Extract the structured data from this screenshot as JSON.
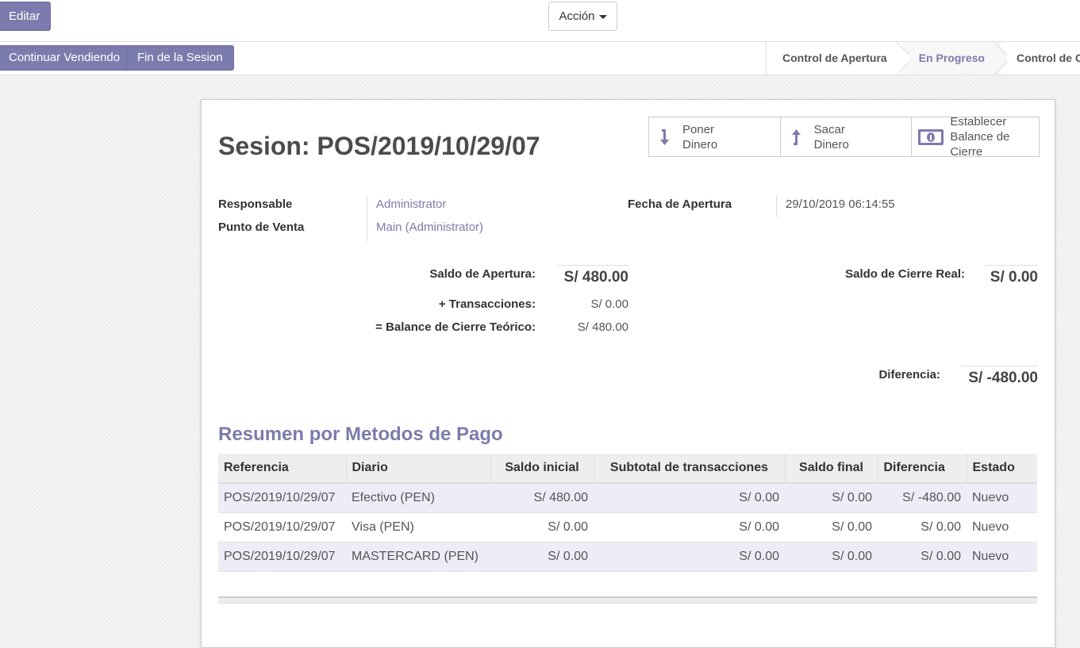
{
  "toolbar": {
    "edit_label": "Editar",
    "action_label": "Acción"
  },
  "session_buttons": {
    "continue_label": "Continuar Vendiendo",
    "end_label": "Fin de la Sesion"
  },
  "status_steps": [
    "Control de Apertura",
    "En Progreso",
    "Control de C"
  ],
  "active_step": "En Progreso",
  "form": {
    "title": "Sesion: POS/2019/10/29/07",
    "smart_buttons": {
      "put_money": "Poner Dinero",
      "take_money": "Sacar Dinero",
      "set_closing_balance": "Establecer Balance de Cierre"
    },
    "responsible_label": "Responsable",
    "responsible_value": "Administrator",
    "pos_label": "Punto de Venta",
    "pos_value": "Main (Administrator)",
    "opening_date_label": "Fecha de Apertura",
    "opening_date_value": "29/10/2019 06:14:55",
    "opening_balance_label": "Saldo de Apertura:",
    "opening_balance_value": "S/ 480.00",
    "transactions_label": "+ Transacciones:",
    "transactions_value": "S/ 0.00",
    "theoretical_label": "= Balance de Cierre Teórico:",
    "theoretical_value": "S/ 480.00",
    "real_closing_label": "Saldo de Cierre Real:",
    "real_closing_value": "S/ 0.00",
    "difference_label": "Diferencia:",
    "difference_value": "S/ -480.00"
  },
  "summary": {
    "title": "Resumen por Metodos de Pago",
    "columns": [
      "Referencia",
      "Diario",
      "Saldo inicial",
      "Subtotal de transacciones",
      "Saldo final",
      "Diferencia",
      "Estado"
    ],
    "rows": [
      [
        "POS/2019/10/29/07",
        "Efectivo (PEN)",
        "S/ 480.00",
        "S/ 0.00",
        "S/ 0.00",
        "S/ -480.00",
        "Nuevo"
      ],
      [
        "POS/2019/10/29/07",
        "Visa (PEN)",
        "S/ 0.00",
        "S/ 0.00",
        "S/ 0.00",
        "S/ 0.00",
        "Nuevo"
      ],
      [
        "POS/2019/10/29/07",
        "MASTERCARD (PEN)",
        "S/ 0.00",
        "S/ 0.00",
        "S/ 0.00",
        "S/ 0.00",
        "Nuevo"
      ]
    ]
  },
  "colors": {
    "accent": "#7c7bad"
  },
  "icons": [
    "arrow-down-icon",
    "arrow-up-icon",
    "money-icon",
    "caret-down-icon"
  ]
}
